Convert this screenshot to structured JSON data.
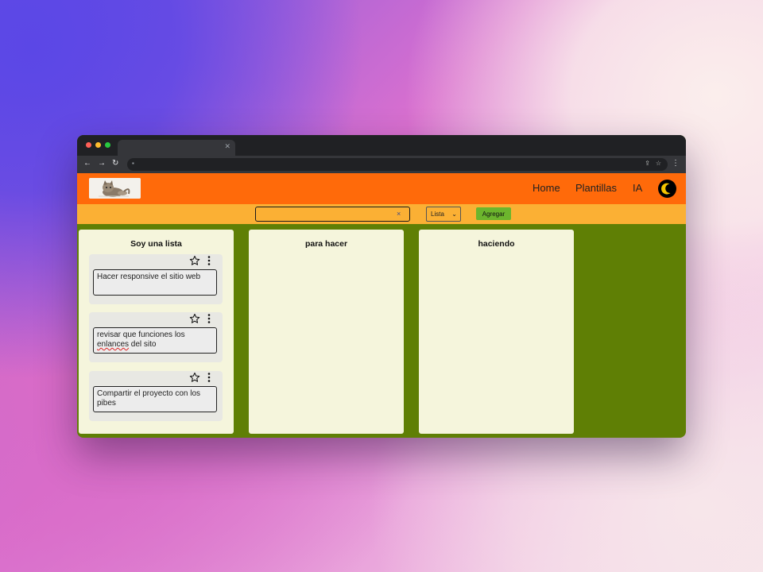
{
  "header": {
    "nav": [
      "Home",
      "Plantillas",
      "IA"
    ]
  },
  "toolbar": {
    "search_value": "",
    "search_clear": "×",
    "list_select": "Lista",
    "add_label": "Agregar"
  },
  "columns": [
    {
      "title": "Soy una lista",
      "cards": [
        {
          "text": "Hacer responsive el sitio web"
        },
        {
          "text_before": "revisar que funciones los ",
          "text_misspelled": "enlances",
          "text_after": " del sito"
        },
        {
          "text": "Compartir el proyecto con los pibes"
        }
      ]
    },
    {
      "title": "para hacer",
      "cards": []
    },
    {
      "title": "haciendo",
      "cards": []
    }
  ],
  "colors": {
    "header_bg": "#ff6a0a",
    "toolbar_bg": "#fbb034",
    "board_bg": "#5f7f05",
    "column_bg": "#f5f5dc",
    "add_button": "#6cb52d"
  }
}
